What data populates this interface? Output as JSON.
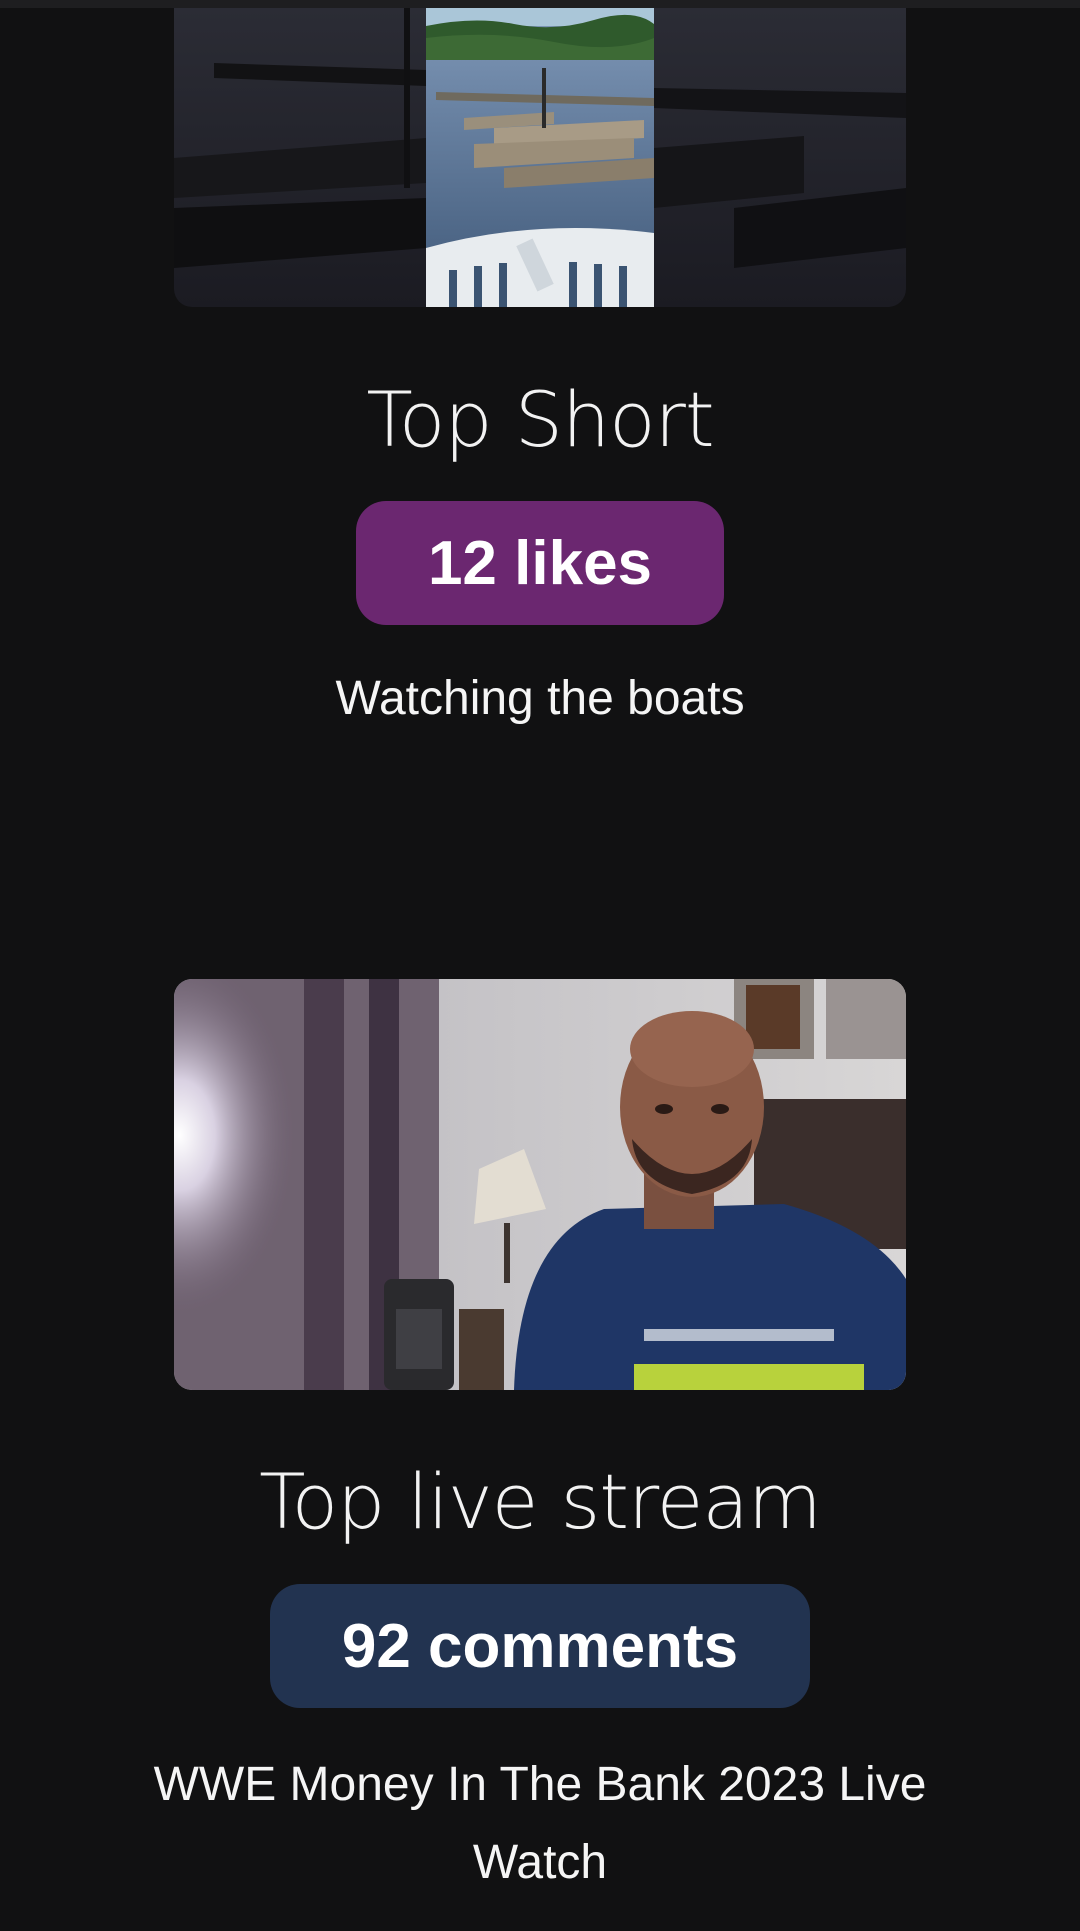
{
  "top_short": {
    "heading": "Top Short",
    "badge": "12 likes",
    "caption": "Watching the boats",
    "badge_color": "#6b2770"
  },
  "top_live_stream": {
    "heading": "Top live stream",
    "badge": "92 comments",
    "caption": "WWE Money In The Bank 2023 Live Watch",
    "badge_color": "#223350"
  },
  "background_color": "#111112"
}
